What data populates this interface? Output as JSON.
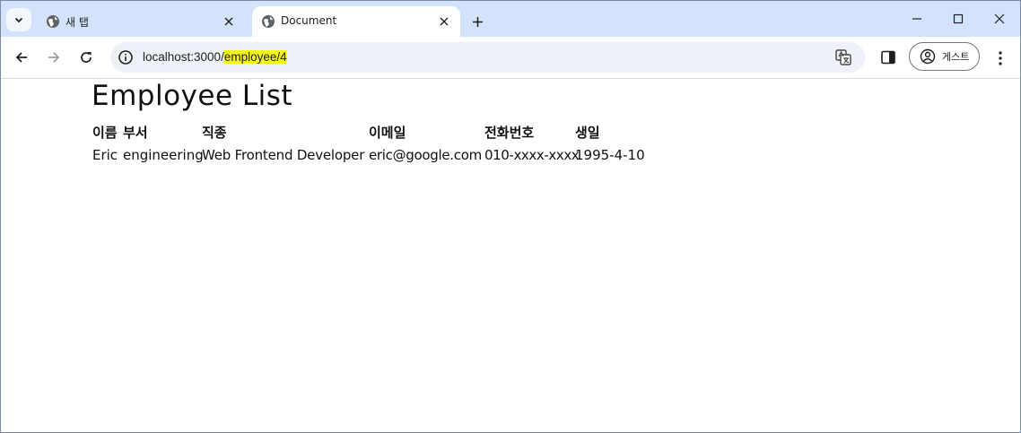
{
  "browser": {
    "tabs": [
      {
        "title": "새 탭",
        "active": false
      },
      {
        "title": "Document",
        "active": true
      }
    ],
    "url_prefix": "localhost:3000/",
    "url_highlight": "employee/4",
    "profile_label": "게스트",
    "colors": {
      "tabstrip": "#d3e3fd",
      "highlight": "#f4f51c"
    }
  },
  "page": {
    "title": "Employee List",
    "columns": [
      "이름",
      "부서",
      "직종",
      "이메일",
      "전화번호",
      "생일"
    ],
    "rows": [
      [
        "Eric",
        "engineering",
        "Web Frontend Developer",
        "eric@google.com",
        "010-xxxx-xxxx",
        "1995-4-10"
      ]
    ]
  }
}
